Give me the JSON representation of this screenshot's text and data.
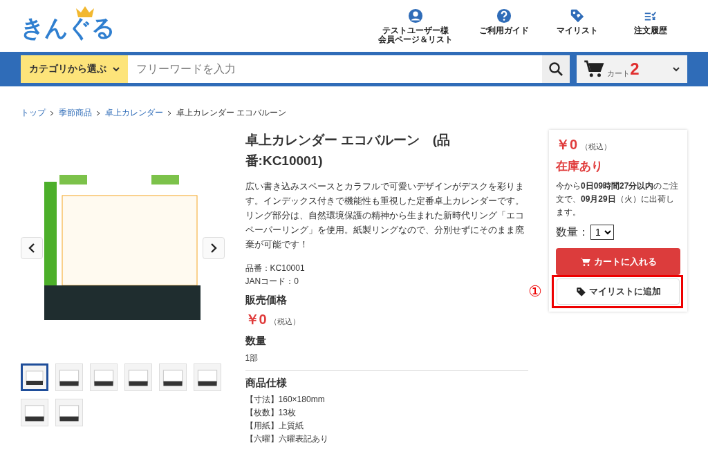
{
  "header": {
    "logo": "きんぐる",
    "nav": [
      {
        "kind": "user",
        "lines": [
          "テストユーザー様",
          "会員ページ＆リスト"
        ]
      },
      {
        "kind": "help",
        "lines": [
          "ご利用ガイド"
        ]
      },
      {
        "kind": "tag",
        "lines": [
          "マイリスト"
        ]
      },
      {
        "kind": "history",
        "lines": [
          "注文履歴"
        ]
      }
    ]
  },
  "search_bar": {
    "category": "カテゴリから選ぶ",
    "placeholder": "フリーワードを入力",
    "cart_label": "カート",
    "cart_count": "2"
  },
  "breadcrumb": [
    {
      "label": "トップ",
      "link": true
    },
    {
      "label": "季節商品",
      "link": true
    },
    {
      "label": "卓上カレンダー",
      "link": true
    },
    {
      "label": "卓上カレンダー エコバルーン",
      "link": false
    }
  ],
  "gallery": {
    "thumbnails": [
      {
        "selected": true
      },
      {
        "selected": false
      },
      {
        "selected": false
      },
      {
        "selected": false
      },
      {
        "selected": false
      },
      {
        "selected": false
      },
      {
        "selected": false
      },
      {
        "selected": false
      }
    ]
  },
  "product": {
    "title": "卓上カレンダー エコバルーン　(品番:KC10001)",
    "description": "広い書き込みスペースとカラフルで可愛いデザインがデスクを彩ります。インデックス付きで機能性も重視した定番卓上カレンダーです。リング部分は、自然環境保護の精神から生まれた新時代リング「エコペーパーリング」を使用。紙製リングなので、分別せずにそのまま廃棄が可能です！",
    "codes": [
      "品番：KC10001",
      "JANコード：0"
    ],
    "price_heading": "販売価格",
    "price": "￥0",
    "tax": "（税込）",
    "quantity_heading": "数量",
    "quantity": "1部",
    "spec_heading": "商品仕様",
    "specs": [
      "【寸法】160×180mm",
      "【枚数】13枚",
      "【用紙】上質紙",
      "【六曜】六曜表記あり"
    ]
  },
  "purchase_box": {
    "price": "￥0",
    "tax": "（税込）",
    "stock": "在庫あり",
    "delivery": "今から**0日09時間27分以内**のご注文で、**09月29日**（火）に出荷します。",
    "quantity_label": "数量：",
    "quantity_value": "1",
    "add_to_cart": "カートに入れる",
    "add_to_list": "マイリストに追加",
    "annotation": "①"
  }
}
